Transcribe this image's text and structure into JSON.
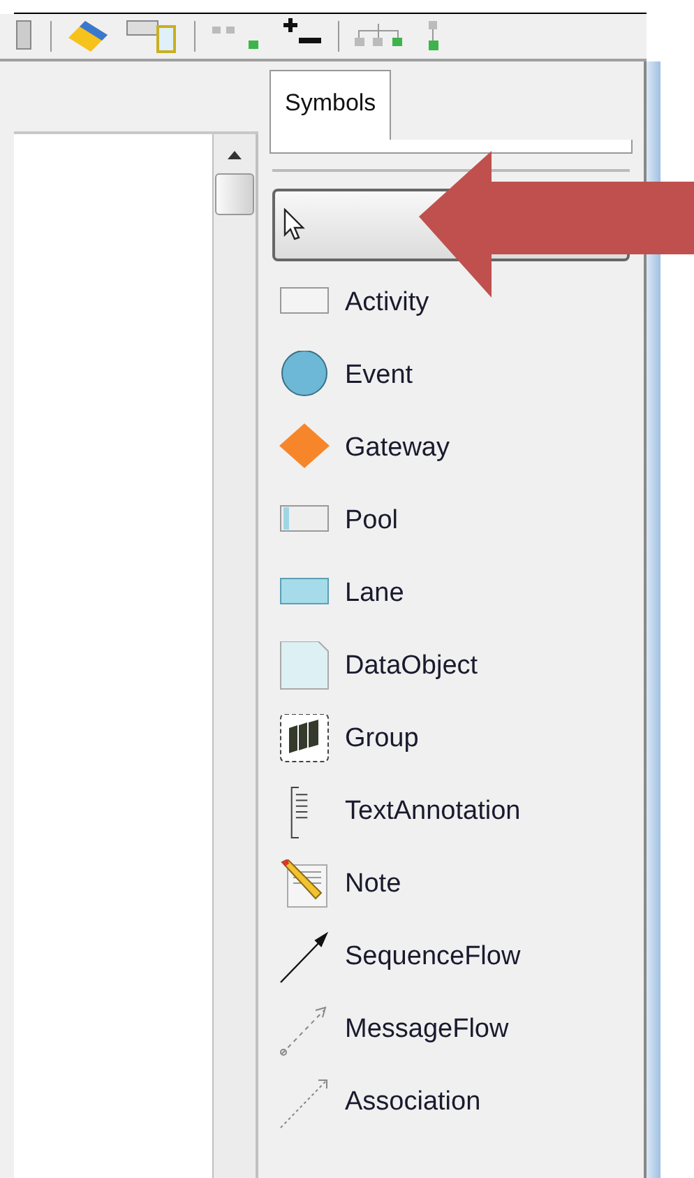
{
  "tabs": [
    {
      "label": "Symbols",
      "selected": true
    }
  ],
  "tools": [
    {
      "kind": "pointer",
      "selected": true
    },
    {
      "kind": "activity",
      "label": "Activity",
      "selected": false
    },
    {
      "kind": "event",
      "label": "Event",
      "selected": false
    },
    {
      "kind": "gateway",
      "label": "Gateway",
      "selected": false
    },
    {
      "kind": "pool",
      "label": "Pool",
      "selected": false
    },
    {
      "kind": "lane",
      "label": "Lane",
      "selected": false
    },
    {
      "kind": "dataobject",
      "label": "DataObject",
      "selected": false
    },
    {
      "kind": "group",
      "label": "Group",
      "selected": false
    },
    {
      "kind": "textannotation",
      "label": "TextAnnotation",
      "selected": false
    },
    {
      "kind": "note",
      "label": "Note",
      "selected": false
    },
    {
      "kind": "sequenceflow",
      "label": "SequenceFlow",
      "selected": false
    },
    {
      "kind": "messageflow",
      "label": "MessageFlow",
      "selected": false
    },
    {
      "kind": "association",
      "label": "Association",
      "selected": false
    }
  ]
}
